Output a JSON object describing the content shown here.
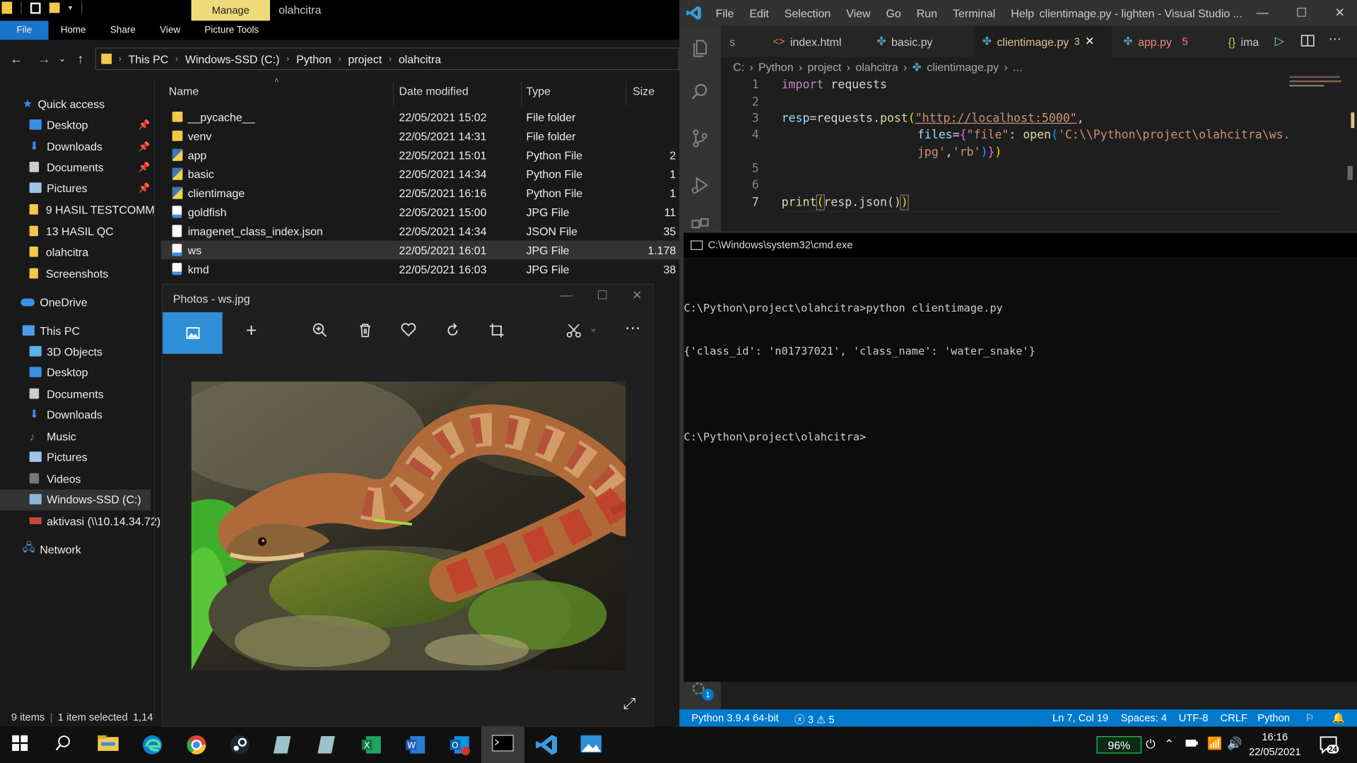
{
  "explorer": {
    "window_title": "olahcitra",
    "manage_tab": "Manage",
    "ribbon_tabs": [
      "File",
      "Home",
      "Share",
      "View",
      "Picture Tools"
    ],
    "breadcrumb": [
      "This PC",
      "Windows-SSD (C:)",
      "Python",
      "project",
      "olahcitra"
    ],
    "nav": {
      "quick_access": "Quick access",
      "items": [
        "Desktop",
        "Downloads",
        "Documents",
        "Pictures",
        "9 HASIL TESTCOMM",
        "13 HASIL QC",
        "olahcitra",
        "Screenshots"
      ],
      "onedrive": "OneDrive",
      "this_pc": "This PC",
      "pc_items": [
        "3D Objects",
        "Desktop",
        "Documents",
        "Downloads",
        "Music",
        "Pictures",
        "Videos",
        "Windows-SSD (C:)",
        "aktivasi (\\\\10.14.34.72)"
      ],
      "network": "Network"
    },
    "columns": [
      "Name",
      "Date modified",
      "Type",
      "Size"
    ],
    "files": [
      {
        "name": "__pycache__",
        "date": "22/05/2021 15:02",
        "type": "File folder",
        "size": ""
      },
      {
        "name": "venv",
        "date": "22/05/2021 14:31",
        "type": "File folder",
        "size": ""
      },
      {
        "name": "app",
        "date": "22/05/2021 15:01",
        "type": "Python File",
        "size": "2"
      },
      {
        "name": "basic",
        "date": "22/05/2021 14:34",
        "type": "Python File",
        "size": "1"
      },
      {
        "name": "clientimage",
        "date": "22/05/2021 16:16",
        "type": "Python File",
        "size": "1"
      },
      {
        "name": "goldfish",
        "date": "22/05/2021 15:00",
        "type": "JPG File",
        "size": "11"
      },
      {
        "name": "imagenet_class_index.json",
        "date": "22/05/2021 14:34",
        "type": "JSON File",
        "size": "35"
      },
      {
        "name": "ws",
        "date": "22/05/2021 16:01",
        "type": "JPG File",
        "size": "1.178"
      },
      {
        "name": "kmd",
        "date": "22/05/2021 16:03",
        "type": "JPG File",
        "size": "38"
      }
    ],
    "status": {
      "items": "9 items",
      "selected": "1 item selected",
      "size": "1,14"
    }
  },
  "photos": {
    "title": "Photos - ws.jpg"
  },
  "vscode": {
    "menu": [
      "File",
      "Edit",
      "Selection",
      "View",
      "Go",
      "Run",
      "Terminal",
      "Help"
    ],
    "window_title": "clientimage.py - lighten - Visual Studio ...",
    "tabs": [
      {
        "label": "index.html",
        "badge": ""
      },
      {
        "label": "basic.py",
        "badge": ""
      },
      {
        "label": "clientimage.py",
        "badge": "3"
      },
      {
        "label": "app.py",
        "badge": "5"
      },
      {
        "label": "ima",
        "badge": ""
      }
    ],
    "tab_partial_left": "s",
    "breadcrumb": [
      "C:",
      "Python",
      "project",
      "olahcitra",
      "clientimage.py",
      "..."
    ],
    "line_numbers": [
      "1",
      "2",
      "3",
      "4",
      "",
      "5",
      "6",
      "7"
    ],
    "code": {
      "l1_kw": "import",
      "l1_rest": " requests",
      "l3_var": "resp",
      "l3_mid": "=requests.",
      "l3_fn": "post",
      "l3_url": "\"http://localhost:5000\"",
      "l4_var": "files",
      "l4_key": "\"file\"",
      "l4_fn": "open",
      "l4_path": "'C:\\\\Python\\project\\olahcitra\\ws.",
      "l4b": "jpg'",
      "l4b_rb": "'rb'",
      "l7_fn": "print",
      "l7_rest": "resp.json()"
    },
    "status": {
      "python": "Python 3.9.4 64-bit",
      "errors": "3",
      "warnings": "5",
      "position": "Ln 7, Col 19",
      "spaces": "Spaces: 4",
      "encoding": "UTF-8",
      "eol": "CRLF",
      "language": "Python"
    },
    "activity_badge": "1"
  },
  "cmd": {
    "title": "C:\\Windows\\system32\\cmd.exe",
    "lines": [
      "C:\\Python\\project\\olahcitra>python clientimage.py",
      "{'class_id': 'n01737021', 'class_name': 'water_snake'}",
      "",
      "C:\\Python\\project\\olahcitra>"
    ]
  },
  "taskbar": {
    "battery": "96%",
    "time": "16:16",
    "date": "22/05/2021",
    "notifications": "24"
  }
}
